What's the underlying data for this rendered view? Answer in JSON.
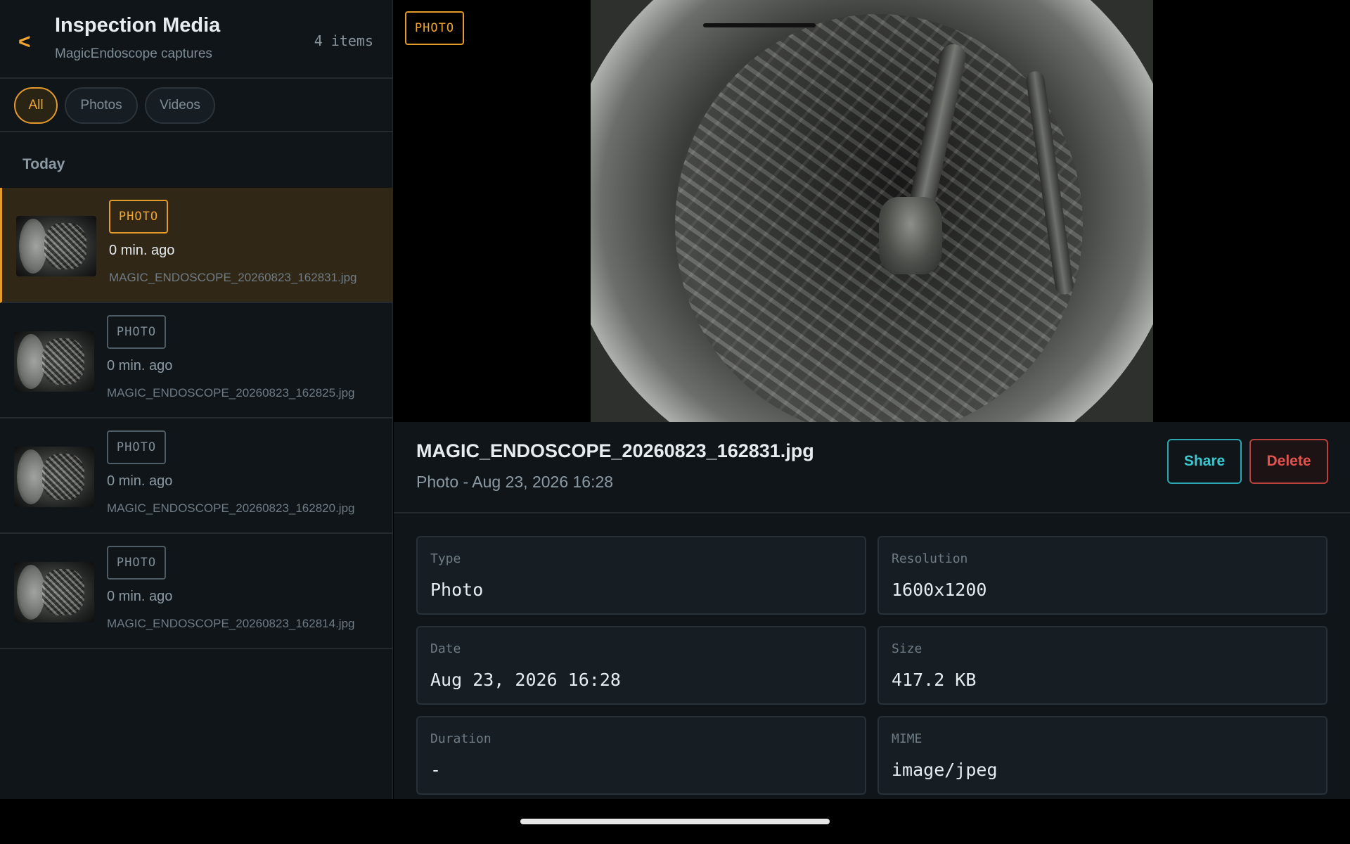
{
  "header": {
    "back_label": "<",
    "title": "Inspection Media",
    "subtitle": "MagicEndoscope captures",
    "count": "4 items"
  },
  "filters": [
    {
      "label": "All",
      "active": true
    },
    {
      "label": "Photos",
      "active": false
    },
    {
      "label": "Videos",
      "active": false
    }
  ],
  "section_label": "Today",
  "items": [
    {
      "badge": "PHOTO",
      "time": "0 min. ago",
      "file": "MAGIC_ENDOSCOPE_20260823_162831.jpg",
      "selected": true
    },
    {
      "badge": "PHOTO",
      "time": "0 min. ago",
      "file": "MAGIC_ENDOSCOPE_20260823_162825.jpg",
      "selected": false
    },
    {
      "badge": "PHOTO",
      "time": "0 min. ago",
      "file": "MAGIC_ENDOSCOPE_20260823_162820.jpg",
      "selected": false
    },
    {
      "badge": "PHOTO",
      "time": "0 min. ago",
      "file": "MAGIC_ENDOSCOPE_20260823_162814.jpg",
      "selected": false
    }
  ],
  "preview": {
    "badge": "PHOTO"
  },
  "detail": {
    "title": "MAGIC_ENDOSCOPE_20260823_162831.jpg",
    "subtitle": "Photo - Aug 23, 2026 16:28",
    "share_label": "Share",
    "delete_label": "Delete"
  },
  "properties": [
    {
      "label": "Type",
      "value": "Photo"
    },
    {
      "label": "Resolution",
      "value": "1600x1200"
    },
    {
      "label": "Date",
      "value": "Aug 23, 2026 16:28"
    },
    {
      "label": "Size",
      "value": "417.2 KB"
    },
    {
      "label": "Duration",
      "value": "-"
    },
    {
      "label": "MIME",
      "value": "image/jpeg"
    }
  ],
  "colors": {
    "accent": "#f0a630",
    "share": "#3cc7cf",
    "delete": "#e0534f",
    "background": "#0f1519"
  }
}
